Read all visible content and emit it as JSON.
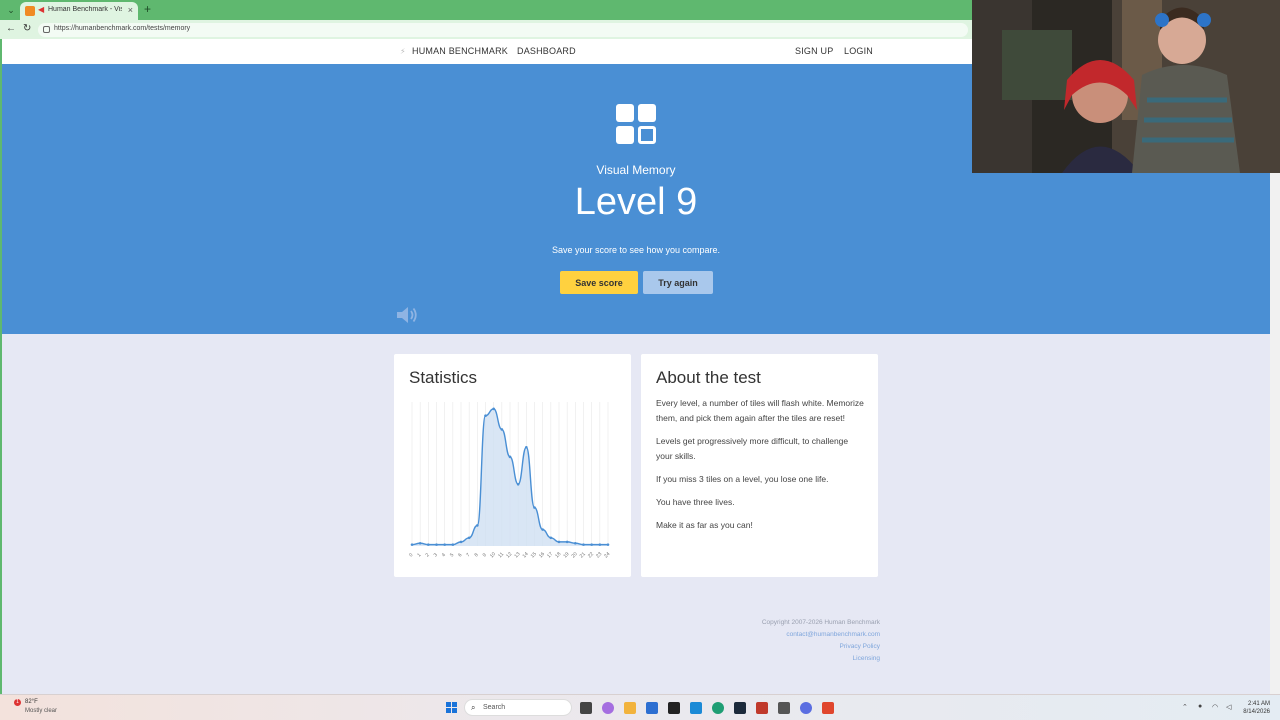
{
  "browser": {
    "tab_title": "Human Benchmark - Visual M",
    "url": "https://humanbenchmark.com/tests/memory"
  },
  "nav": {
    "brand": "HUMAN BENCHMARK",
    "dashboard": "DASHBOARD",
    "signup": "SIGN UP",
    "login": "LOGIN"
  },
  "hero": {
    "test_name": "Visual Memory",
    "result": "Level 9",
    "message": "Save your score to see how you compare.",
    "save_label": "Save score",
    "again_label": "Try again",
    "bg_color": "#4a8fd4"
  },
  "stats": {
    "title": "Statistics"
  },
  "about": {
    "title": "About the test",
    "paragraphs": [
      "Every level, a number of tiles will flash white. Memorize them, and pick them again after the tiles are reset!",
      "Levels get progressively more difficult, to challenge your skills.",
      "If you miss 3 tiles on a level, you lose one life.",
      "You have three lives.",
      "Make it as far as you can!"
    ]
  },
  "footer": {
    "copyright": "Copyright 2007-2026 Human Benchmark",
    "contact": "contact@humanbenchmark.com",
    "privacy": "Privacy Policy",
    "licensing": "Licensing"
  },
  "taskbar": {
    "weather_badge": "1",
    "temperature": "82°F",
    "condition": "Mostly clear",
    "search_placeholder": "Search",
    "time": "2:41 AM",
    "date": "8/14/2026"
  },
  "chart_data": {
    "type": "area",
    "x": [
      0,
      1,
      2,
      3,
      4,
      5,
      6,
      7,
      8,
      9,
      10,
      11,
      12,
      13,
      14,
      15,
      16,
      17,
      18,
      19,
      20,
      21,
      22,
      23,
      24
    ],
    "values": [
      0.01,
      0.02,
      0.01,
      0.01,
      0.01,
      0.01,
      0.03,
      0.06,
      0.15,
      0.95,
      1.0,
      0.85,
      0.65,
      0.45,
      0.72,
      0.28,
      0.12,
      0.06,
      0.03,
      0.03,
      0.02,
      0.01,
      0.01,
      0.01,
      0.01
    ],
    "ylim": [
      0,
      1.05
    ],
    "line_color": "#4a8fd4",
    "fill_color": "#cfe0f3",
    "grid": true
  }
}
